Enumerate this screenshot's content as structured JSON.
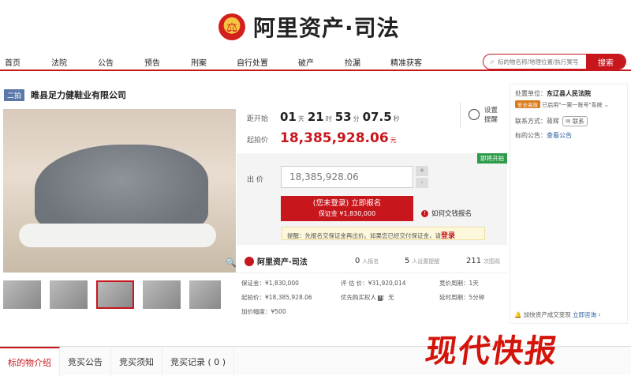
{
  "brand": {
    "name": "阿里资产·司法",
    "emblem": "court-emblem"
  },
  "nav": [
    "首页",
    "法院",
    "公告",
    "预告",
    "刑案",
    "自行处置",
    "破产",
    "捡漏",
    "精准获客"
  ],
  "search": {
    "placeholder": "标的物名称/地理位置/执行案号",
    "button": "搜索"
  },
  "item": {
    "badge": "二拍",
    "title": "睢县足力健鞋业有限公司"
  },
  "countdown": {
    "label": "距开始",
    "days": "01",
    "day_unit": "天",
    "hours": "21",
    "hour_unit": "时",
    "minutes": "53",
    "minute_unit": "分",
    "seconds": "07.5",
    "second_unit": "秒"
  },
  "remind": {
    "label": "设置提醒"
  },
  "start_price": {
    "label": "起拍价",
    "value": "18,385,928.06",
    "unit": "元"
  },
  "bid": {
    "tag": "即将开拍",
    "label": "出 价",
    "value": "18,385,928.06",
    "plus": "+",
    "minus": "-",
    "button_line1": "(您未登录) 立即报名",
    "button_line2": "保证金 ¥1,830,000",
    "how_bond": "如何交钱报名",
    "notice_text": "提醒：先报名交保证金再出价。如果您已经交付保证金，请",
    "notice_link": "登录"
  },
  "stats": {
    "brand": "阿里资产·司法",
    "signups": "0",
    "signups_label": "人报名",
    "reminders": "5",
    "reminders_label": "人设置提醒",
    "views": "211",
    "views_label": "次围观"
  },
  "details": {
    "deposit": "保证金：¥1,830,000",
    "estimate": "评 估 价：¥31,920,014",
    "cycle": "竞价周期：1天",
    "start": "起拍价：¥18,385,928.06",
    "priority": "优先购买权人",
    "priority_value": "：无",
    "delay": "延时周期：5分钟",
    "increment": "加价幅度：¥500"
  },
  "sidebar": {
    "unit_label": "处置单位：",
    "unit": "东辽县人民法院",
    "security_badge": "安全高效",
    "security_text": "已启用\"一案一账号\"系统",
    "contact_label": "联系方式：",
    "contact_name": "蒋辉",
    "contact_btn": "联系",
    "notice_label": "标的公告：",
    "notice_link": "查看公告",
    "bottom_text": "加快资产成交变现",
    "bottom_link": "立即咨询"
  },
  "tabs": [
    "标的物介绍",
    "竞买公告",
    "竞买须知",
    "竞买记录 ( 0 )"
  ],
  "watermark": "现代快报",
  "colors": {
    "accent": "#c8161d",
    "badge": "#5a78a8",
    "green": "#2e9b4a"
  }
}
